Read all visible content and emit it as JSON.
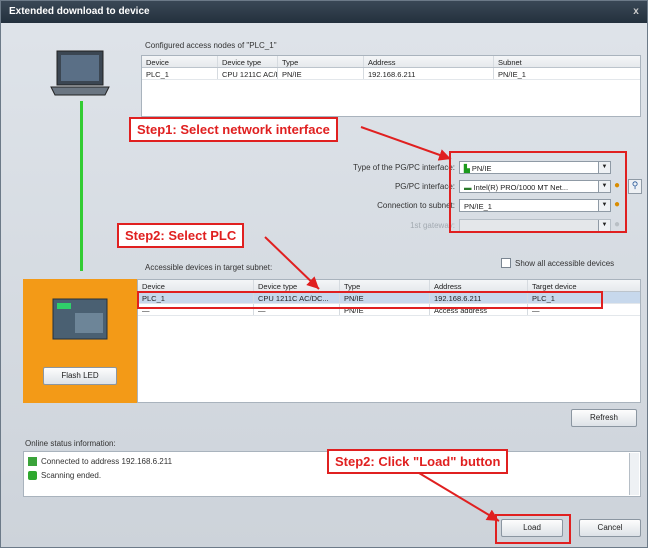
{
  "window": {
    "title": "Extended download to device",
    "close_glyph": "x"
  },
  "configured": {
    "title": "Configured access nodes of \"PLC_1\"",
    "columns": [
      "Device",
      "Device type",
      "Type",
      "Address",
      "Subnet"
    ],
    "rows": [
      [
        "PLC_1",
        "CPU 1211C AC/DC...",
        "PN/IE",
        "192.168.6.211",
        "PN/IE_1"
      ]
    ]
  },
  "interface": {
    "type_label": "Type of the PG/PC interface:",
    "type_value": "PN/IE",
    "pgpc_label": "PG/PC interface:",
    "pgpc_value": "Intel(R) PRO/1000 MT Net...",
    "subnet_label": "Connection to subnet:",
    "subnet_value": "PN/IE_1",
    "gateway_label": "1st gateway:"
  },
  "accessible": {
    "title": "Accessible devices in target subnet:",
    "show_all_label": "Show all accessible devices",
    "columns": [
      "Device",
      "Device type",
      "Type",
      "Address",
      "Target device"
    ],
    "rows": [
      [
        "PLC_1",
        "CPU 1211C AC/DC...",
        "PN/IE",
        "192.168.6.211",
        "PLC_1"
      ],
      [
        "—",
        "—",
        "PN/IE",
        "Access address",
        "—"
      ]
    ]
  },
  "buttons": {
    "flash_led": "Flash LED",
    "refresh": "Refresh",
    "load": "Load",
    "cancel": "Cancel"
  },
  "status": {
    "title": "Online status information:",
    "lines": [
      "Connected to address 192.168.6.211",
      "Scanning ended."
    ]
  },
  "annotations": {
    "step1": "Step1: Select network interface",
    "step2_plc": "Step2: Select PLC",
    "step2_load": "Step2: Click \"Load\" button"
  },
  "colors": {
    "annotation": "#e02020",
    "plc_panel": "#f39a17",
    "link_line": "#33cc33"
  }
}
